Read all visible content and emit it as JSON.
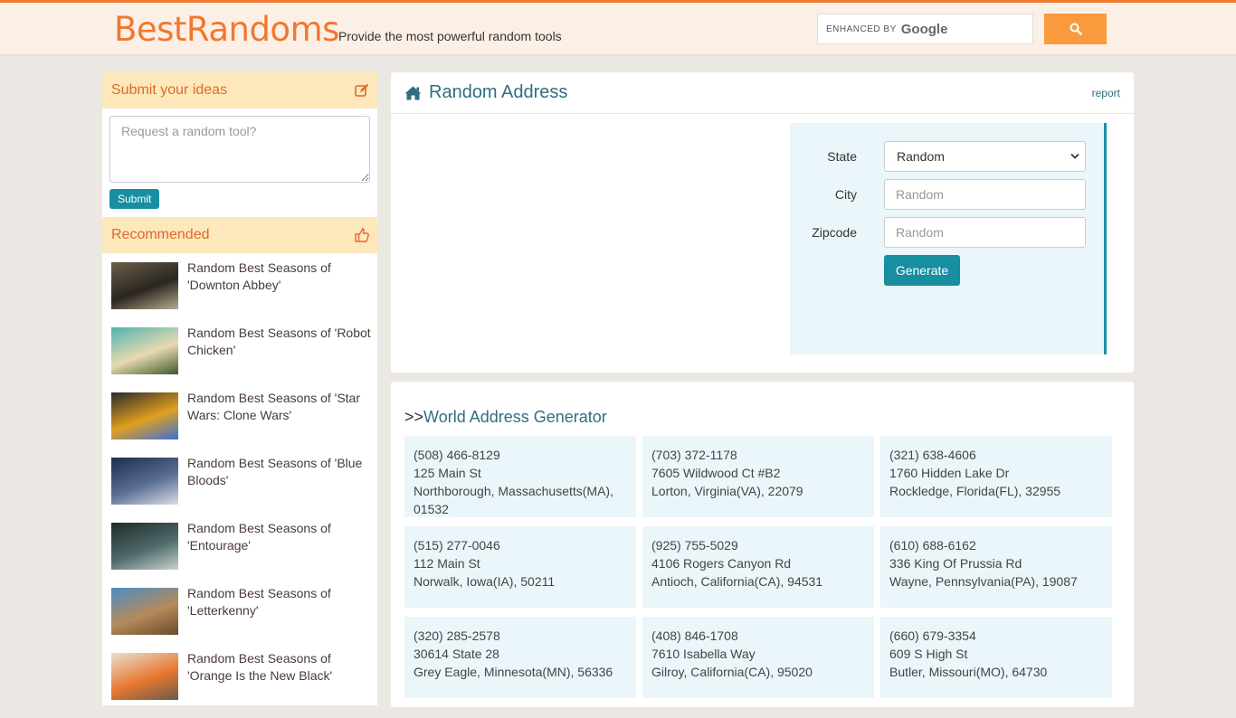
{
  "header": {
    "logo": "BestRandoms",
    "tagline": "Provide the most powerful random tools",
    "search": {
      "enhanced_by": "ENHANCED BY",
      "brand": "Google",
      "icon": "search-icon"
    }
  },
  "sidebar": {
    "ideas": {
      "title": "Submit your ideas",
      "icon": "edit-icon",
      "placeholder": "Request a random tool?",
      "submit_label": "Submit"
    },
    "recommended": {
      "title": "Recommended",
      "icon": "thumbs-up-icon",
      "items": [
        {
          "label": "Random Best Seasons of 'Downton Abbey'",
          "thumb_colors": [
            "#6b5e4a",
            "#2a2620",
            "#b9ab8e"
          ]
        },
        {
          "label": "Random Best Seasons of 'Robot Chicken'",
          "thumb_colors": [
            "#4fb3b0",
            "#e8d9b0",
            "#3b5a2a"
          ]
        },
        {
          "label": "Random Best Seasons of 'Star Wars: Clone Wars'",
          "thumb_colors": [
            "#2a2a2a",
            "#e0a020",
            "#3a70d8"
          ]
        },
        {
          "label": "Random Best Seasons of 'Blue Bloods'",
          "thumb_colors": [
            "#1d2d4d",
            "#5a6f94",
            "#d9dde6"
          ]
        },
        {
          "label": "Random Best Seasons of 'Entourage'",
          "thumb_colors": [
            "#1e2a2a",
            "#4f6a6a",
            "#c7d2cf"
          ]
        },
        {
          "label": "Random Best Seasons of 'Letterkenny'",
          "thumb_colors": [
            "#4a8ec8",
            "#b58a5a",
            "#6a4a2a"
          ]
        },
        {
          "label": "Random Best Seasons of 'Orange Is the New Black'",
          "thumb_colors": [
            "#e8e0d0",
            "#e87830",
            "#6a5a4a"
          ]
        }
      ]
    }
  },
  "main": {
    "title": "Random Address",
    "title_icon": "home-icon",
    "report_label": "report",
    "form": {
      "state_label": "State",
      "state_value": "Random",
      "city_label": "City",
      "city_placeholder": "Random",
      "zip_label": "Zipcode",
      "zip_placeholder": "Random",
      "generate_label": "Generate"
    }
  },
  "world": {
    "prefix": ">>",
    "title": "World Address Generator",
    "addresses": [
      {
        "phone": "(508) 466-8129",
        "street": "125 Main St",
        "city_line": "Northborough, Massachusetts(MA), 01532"
      },
      {
        "phone": "(703) 372-1178",
        "street": "7605 Wildwood Ct #B2",
        "city_line": "Lorton, Virginia(VA), 22079"
      },
      {
        "phone": "(321) 638-4606",
        "street": "1760 Hidden Lake Dr",
        "city_line": "Rockledge, Florida(FL), 32955"
      },
      {
        "phone": "(515) 277-0046",
        "street": "112 Main St",
        "city_line": "Norwalk, Iowa(IA), 50211"
      },
      {
        "phone": "(925) 755-5029",
        "street": "4106 Rogers Canyon Rd",
        "city_line": "Antioch, California(CA), 94531"
      },
      {
        "phone": "(610) 688-6162",
        "street": "336 King Of Prussia Rd",
        "city_line": "Wayne, Pennsylvania(PA), 19087"
      },
      {
        "phone": "(320) 285-2578",
        "street": "30614 State 28",
        "city_line": "Grey Eagle, Minnesota(MN), 56336"
      },
      {
        "phone": "(408) 846-1708",
        "street": "7610 Isabella Way",
        "city_line": "Gilroy, California(CA), 95020"
      },
      {
        "phone": "(660) 679-3354",
        "street": "609 S High St",
        "city_line": "Butler, Missouri(MO), 64730"
      }
    ]
  },
  "colors": {
    "brand_orange": "#f07830",
    "accent_teal": "#188ea1",
    "panel_bg": "#eaf6fa",
    "side_head_bg": "#fde8bb"
  }
}
